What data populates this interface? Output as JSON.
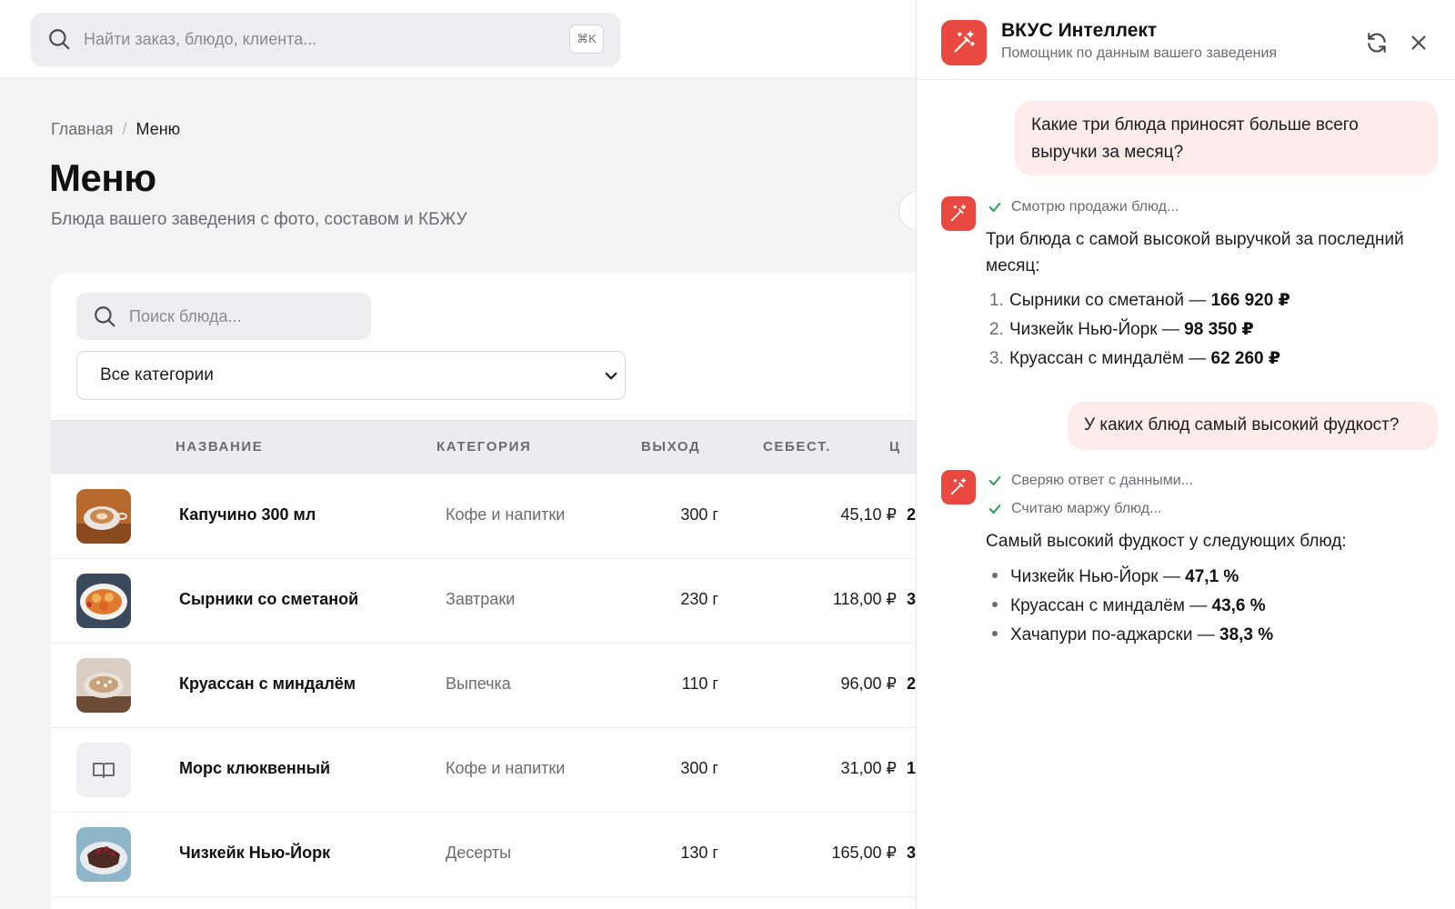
{
  "header": {
    "search_placeholder": "Найти заказ, блюдо, клиента...",
    "shortcut": "⌘K"
  },
  "breadcrumb": {
    "home": "Главная",
    "separator": "/",
    "current": "Меню"
  },
  "page": {
    "title": "Меню",
    "subtitle": "Блюда вашего заведения с фото, составом и КБЖУ"
  },
  "menu_table": {
    "search_placeholder": "Поиск блюда...",
    "category_filter": "Все категории",
    "columns": {
      "name": "НАЗВАНИЕ",
      "category": "КАТЕГОРИЯ",
      "output": "ВЫХОД",
      "cost": "СЕБЕСТ.",
      "next": "Ц"
    },
    "rows": [
      {
        "name": "Капучино 300 мл",
        "category": "Кофе и напитки",
        "output": "300 г",
        "cost": "45,10 ₽",
        "next": "2",
        "thumb": "cappuccino"
      },
      {
        "name": "Сырники со сметаной",
        "category": "Завтраки",
        "output": "230 г",
        "cost": "118,00 ₽",
        "next": "3",
        "thumb": "syrniki"
      },
      {
        "name": "Круассан с миндалём",
        "category": "Выпечка",
        "output": "110 г",
        "cost": "96,00 ₽",
        "next": "2",
        "thumb": "croissant"
      },
      {
        "name": "Морс клюквенный",
        "category": "Кофе и напитки",
        "output": "300 г",
        "cost": "31,00 ₽",
        "next": "1",
        "thumb": "book-placeholder-icon"
      },
      {
        "name": "Чизкейк Нью-Йорк",
        "category": "Десерты",
        "output": "130 г",
        "cost": "165,00 ₽",
        "next": "3",
        "thumb": "cheesecake"
      }
    ]
  },
  "assistant": {
    "title": "ВКУС Интеллект",
    "subtitle": "Помощник по данным вашего заведения",
    "accent": "#e8483f",
    "user_bubble_color": "#fdecea",
    "messages": [
      {
        "role": "user",
        "text": "Какие три блюда приносят больше всего выручки за месяц?"
      },
      {
        "role": "assistant",
        "steps": [
          "Смотрю продажи блюд..."
        ],
        "intro": "Три блюда с самой высокой выручкой за последний месяц:",
        "items": [
          {
            "num": "1.",
            "label": "Сырники со сметаной — ",
            "value": "166 920 ₽"
          },
          {
            "num": "2.",
            "label": "Чизкейк Нью-Йорк — ",
            "value": "98 350 ₽"
          },
          {
            "num": "3.",
            "label": "Круассан с миндалём — ",
            "value": "62 260 ₽"
          }
        ]
      },
      {
        "role": "user",
        "text": "У каких блюд самый высокий фудкост?"
      },
      {
        "role": "assistant",
        "steps": [
          "Сверяю ответ с данными...",
          "Считаю маржу блюд..."
        ],
        "intro": "Самый высокий фудкост у следующих блюд:",
        "items": [
          {
            "label": "Чизкейк Нью-Йорк — ",
            "value": "47,1 %"
          },
          {
            "label": "Круассан с миндалём — ",
            "value": "43,6 %"
          },
          {
            "label": "Хачапури по-аджарски — ",
            "value": "38,3 %"
          }
        ]
      }
    ]
  }
}
